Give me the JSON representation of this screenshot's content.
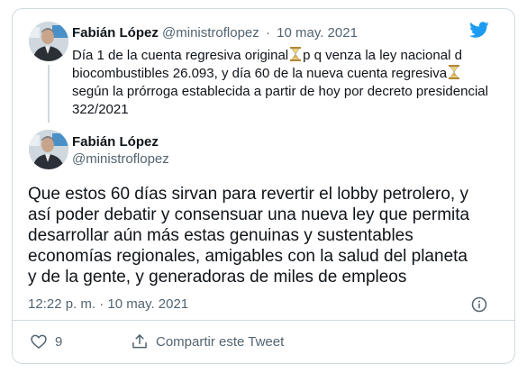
{
  "quoted_tweet": {
    "author_name": "Fabián López",
    "author_handle": "@ministroflopez",
    "separator": "·",
    "date": "10 may. 2021",
    "lines": [
      [
        "Día 1 de la cuenta regresiva original",
        "hourglass",
        "p q venza la ley nacional d"
      ],
      [
        "biocombustibles 26.093, y día 60 de la nueva cuenta regresiva",
        "hourglass",
        ""
      ],
      [
        "según la prórroga establecida a partir de hoy por decreto presidencial",
        "",
        ""
      ],
      [
        "322/2021",
        "",
        ""
      ]
    ]
  },
  "tweet": {
    "author_name": "Fabián López",
    "author_handle": "@ministroflopez",
    "text_lines": [
      "Que estos 60 días sirvan para revertir el lobby petrolero, y",
      "así poder debatir y consensuar una nueva ley que permita",
      "desarrollar aún más estas genuinas y sustentables",
      "economías regionales, amigables con la salud del planeta",
      "y de la gente, y generadoras de miles de empleos"
    ],
    "timestamp": "12:22 p. m. · 10 may. 2021"
  },
  "actions": {
    "like_count": "9",
    "share_label": "Compartir este Tweet"
  },
  "icons": {
    "brand": "twitter-bird-icon",
    "emoji": "hourglass-icon",
    "like": "heart-icon",
    "share": "share-icon",
    "info": "info-icon"
  },
  "colors": {
    "brand": "#1d9bf0",
    "text": "#0f1419",
    "secondary": "#536471",
    "border": "#cfd9de"
  }
}
